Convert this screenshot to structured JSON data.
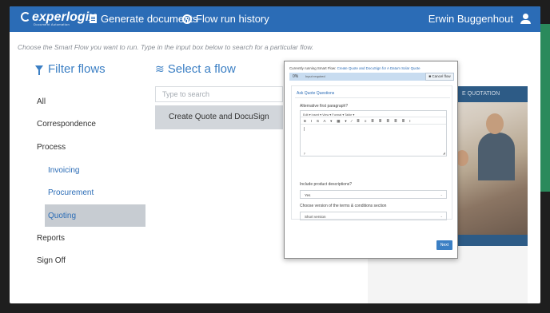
{
  "header": {
    "logo_text": "experlogix",
    "logo_tagline": "Document Automation",
    "nav_generate": "Generate documents",
    "nav_history": "Flow run history",
    "user_name": "Erwin Buggenhout"
  },
  "instructions": "Choose the Smart Flow you want to run. Type in the input box below to search for a particular flow.",
  "filter": {
    "heading": "Filter flows",
    "items": {
      "all": "All",
      "correspondence": "Correspondence",
      "process": "Process",
      "invoicing": "Invoicing",
      "procurement": "Procurement",
      "quoting": "Quoting",
      "reports": "Reports",
      "sign_off": "Sign Off"
    }
  },
  "select": {
    "heading": "Select a flow",
    "search_placeholder": "Type to search",
    "flows": [
      "Create Quote and DocuSign"
    ]
  },
  "background_doc": {
    "banner": "E QUOTATION"
  },
  "modal": {
    "running_prefix": "Currently running Smart Flow:",
    "running_flow": "Create Quote and DocuSign for A Datum Solar Quote",
    "progress_pct": "0%",
    "progress_msg": "Input required",
    "cancel_label": "Cancel flow",
    "section_title": "Ask Quote Questions",
    "q1_label": "Alternative first paragraph?",
    "editor_menu": "Edit ▾   Insert ▾   View ▾   Format ▾   Table ▾",
    "editor_tools": "B I S A ▾ ▦ ▾ ⁄ ≣ ≡ ≣ ≣ ≣ ≣ ≣ I",
    "editor_caret": "|",
    "editor_footer": "p",
    "q2_label": "Include product descriptions?",
    "q2_value": "Yes",
    "q3_label": "Choose version of the terms & conditions section",
    "q3_value": "Short version",
    "next_label": "Next"
  },
  "colors": {
    "topbar": "#2b6cb6",
    "accent": "#3b7fc4",
    "selected_bg": "#c7ccd2",
    "green_strip": "#2a8a5c"
  }
}
